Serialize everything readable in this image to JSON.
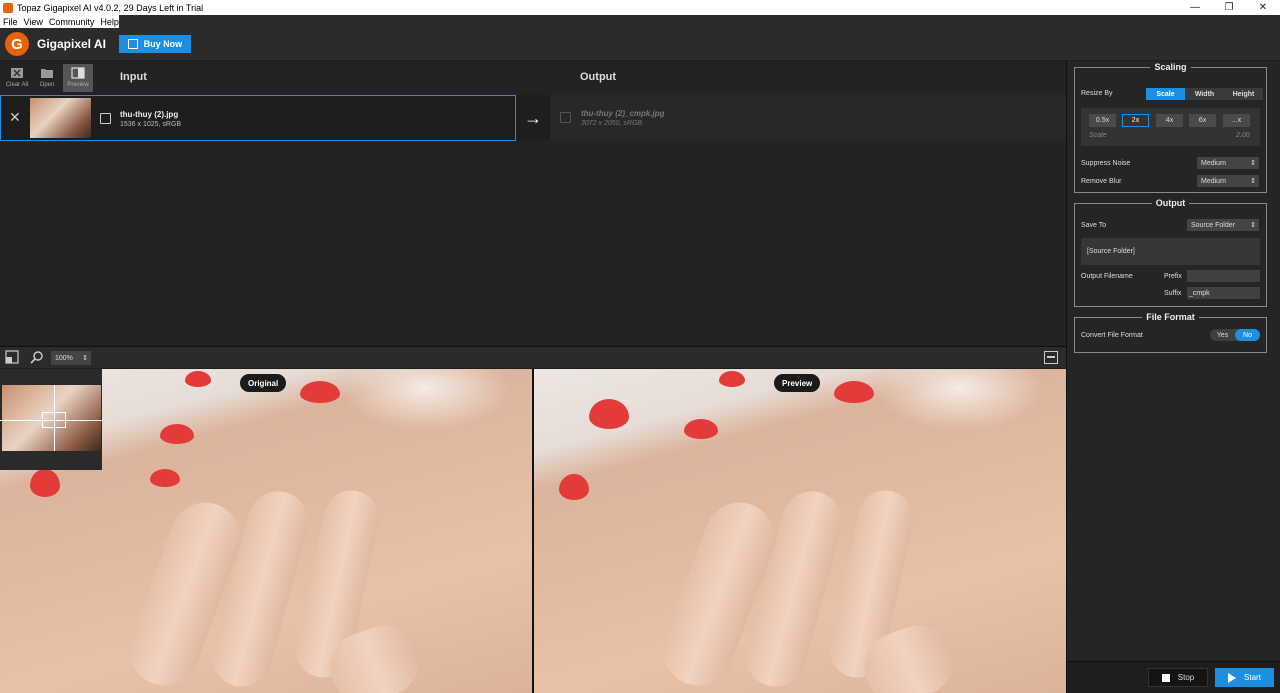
{
  "window": {
    "title": "Topaz Gigapixel AI v4.0.2, 29 Days Left in Trial"
  },
  "menu": [
    "File",
    "View",
    "Community",
    "Help"
  ],
  "header": {
    "brand": "Gigapixel AI",
    "logo_letter": "G",
    "buy_label": "Buy Now"
  },
  "toolbar": {
    "clear_all": "Clear All",
    "open": "Open",
    "preview": "Preview"
  },
  "columns": {
    "input": "Input",
    "output": "Output"
  },
  "input_file": {
    "name": "thu-thuy (2).jpg",
    "meta": "1536 x 1025, sRGB"
  },
  "output_file": {
    "name": "thu-thuy (2)_cmpk.jpg",
    "meta": "3072 x 2050, sRGB"
  },
  "preview": {
    "zoom": "100%",
    "original_label": "Original",
    "preview_label": "Preview"
  },
  "scaling": {
    "title": "Scaling",
    "resize_by_label": "Resize By",
    "modes": [
      "Scale",
      "Width",
      "Height"
    ],
    "active_mode": "Scale",
    "scale_buttons": [
      "0.5x",
      "2x",
      "4x",
      "6x",
      "...x"
    ],
    "active_scale": "2x",
    "scale_label": "Scale",
    "scale_value": "2.00",
    "suppress_noise_label": "Suppress Noise",
    "suppress_noise_value": "Medium",
    "remove_blur_label": "Remove Blur",
    "remove_blur_value": "Medium"
  },
  "output": {
    "title": "Output",
    "save_to_label": "Save To",
    "save_to_value": "Source Folder",
    "folder_path": "[Source Folder]",
    "filename_label": "Output Filename",
    "prefix_label": "Prefix",
    "prefix_value": "",
    "suffix_label": "Suffix",
    "suffix_value": "_cmpk"
  },
  "file_format": {
    "title": "File Format",
    "convert_label": "Convert File Format",
    "yes": "Yes",
    "no": "No",
    "active": "No"
  },
  "actions": {
    "stop": "Stop",
    "start": "Start"
  },
  "colors": {
    "accent": "#1c8fe3",
    "logo": "#e8620a",
    "background": "#1e1e1e"
  }
}
